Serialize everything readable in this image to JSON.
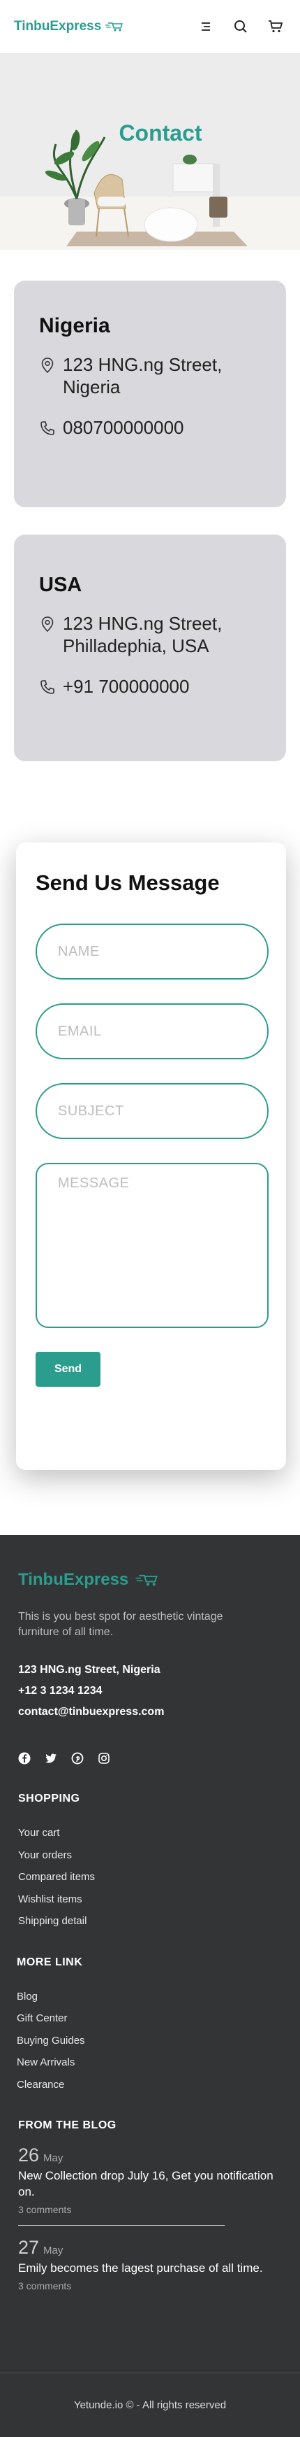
{
  "header": {
    "brand": "TinbuExpress"
  },
  "hero": {
    "title": "Contact"
  },
  "contacts": [
    {
      "country": "Nigeria",
      "address": "123 HNG.ng Street, Nigeria",
      "phone": "080700000000"
    },
    {
      "country": "USA",
      "address": "123 HNG.ng Street, Philladephia, USA",
      "phone": "+91 700000000"
    }
  ],
  "form": {
    "title": "Send Us Message",
    "name_placeholder": "NAME",
    "email_placeholder": "EMAIL",
    "subject_placeholder": "SUBJECT",
    "message_placeholder": "MESSAGE",
    "send_label": "Send"
  },
  "footer": {
    "brand": "TinbuExpress",
    "tagline": "This is you best spot for aesthetic vintage furniture of all time.",
    "address": "123 HNG.ng Street, Nigeria",
    "phone": "+12 3 1234 1234",
    "email": "contact@tinbuexpress.com",
    "socials": [
      "facebook-icon",
      "twitter-icon",
      "pinterest-icon",
      "instagram-icon"
    ],
    "shopping_heading": "SHOPPING",
    "shopping_links": [
      "Your cart",
      "Your orders",
      "Compared items",
      "Wishlist items",
      "Shipping detail"
    ],
    "more_heading": "MORE LINK",
    "more_links": [
      "Blog",
      "Gift Center",
      "Buying Guides",
      "New Arrivals",
      "Clearance"
    ],
    "blog_heading": "FROM THE BLOG",
    "blog": [
      {
        "day": "26",
        "month": "May",
        "title": "New Collection drop July 16, Get you notification on.",
        "comments": "3 comments"
      },
      {
        "day": "27",
        "month": "May",
        "title": "Emily becomes the lagest purchase of all time.",
        "comments": "3 comments"
      }
    ],
    "copyright": "Yetunde.io © - All rights reserved"
  },
  "colors": {
    "accent": "#2a9d8f",
    "card_bg": "#d8d8dd",
    "footer_bg": "#333436"
  }
}
